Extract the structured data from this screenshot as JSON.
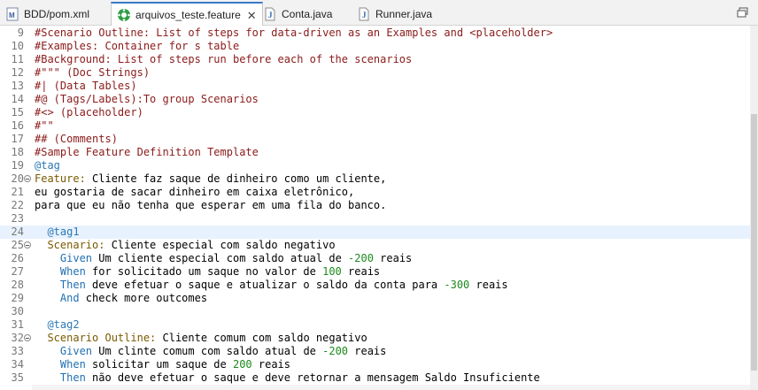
{
  "tabs": [
    {
      "label": "BDD/pom.xml",
      "icon": "maven-file-icon",
      "active": false
    },
    {
      "label": "arquivos_teste.feature",
      "icon": "cucumber-icon",
      "active": true
    },
    {
      "label": "Conta.java",
      "icon": "java-file-icon",
      "active": false
    },
    {
      "label": "Runner.java",
      "icon": "java-file-icon",
      "active": false
    }
  ],
  "colors": {
    "comment": "#8b1a1a",
    "tag": "#2d78b4",
    "keyword": "#7a5a00",
    "step": "#1f6fb2",
    "number": "#1d8a1d",
    "current_line": "#e8f2fe",
    "active_tab_accent": "#3b78c9"
  },
  "editor": {
    "current_line": 24,
    "lines": [
      {
        "n": "9",
        "segs": [
          {
            "t": "#Scenario Outline: List of steps for data-driven as an Examples and <placeholder>",
            "c": "comment"
          }
        ]
      },
      {
        "n": "10",
        "segs": [
          {
            "t": "#Examples: Container for s table",
            "c": "comment"
          }
        ]
      },
      {
        "n": "11",
        "segs": [
          {
            "t": "#Background: List of steps run before each of the scenarios",
            "c": "comment"
          }
        ]
      },
      {
        "n": "12",
        "segs": [
          {
            "t": "#\"\"\" (Doc Strings)",
            "c": "comment"
          }
        ]
      },
      {
        "n": "13",
        "segs": [
          {
            "t": "#| (Data Tables)",
            "c": "comment"
          }
        ]
      },
      {
        "n": "14",
        "segs": [
          {
            "t": "#@ (Tags/Labels):To group Scenarios",
            "c": "comment"
          }
        ]
      },
      {
        "n": "15",
        "segs": [
          {
            "t": "#<> (placeholder)",
            "c": "comment"
          }
        ]
      },
      {
        "n": "16",
        "segs": [
          {
            "t": "#\"\"",
            "c": "comment"
          }
        ]
      },
      {
        "n": "17",
        "segs": [
          {
            "t": "## (Comments)",
            "c": "comment"
          }
        ]
      },
      {
        "n": "18",
        "segs": [
          {
            "t": "#Sample Feature Definition Template",
            "c": "comment"
          }
        ]
      },
      {
        "n": "19",
        "segs": [
          {
            "t": "@tag",
            "c": "tag"
          }
        ]
      },
      {
        "n": "20",
        "fold": true,
        "segs": [
          {
            "t": "Feature:",
            "c": "kw"
          },
          {
            "t": " Cliente faz saque de dinheiro como um cliente,",
            "c": "text"
          }
        ]
      },
      {
        "n": "21",
        "segs": [
          {
            "t": "eu gostaria de sacar dinheiro em caixa eletrônico,",
            "c": "text"
          }
        ]
      },
      {
        "n": "22",
        "segs": [
          {
            "t": "para que eu não tenha que esperar em uma fila do banco.",
            "c": "text"
          }
        ]
      },
      {
        "n": "23",
        "segs": []
      },
      {
        "n": "24",
        "segs": [
          {
            "t": "  @tag1",
            "c": "tag"
          }
        ]
      },
      {
        "n": "25",
        "fold": true,
        "segs": [
          {
            "t": "  Scenario:",
            "c": "kw"
          },
          {
            "t": " Cliente especial com saldo negativo",
            "c": "text"
          }
        ]
      },
      {
        "n": "26",
        "segs": [
          {
            "t": "    Given",
            "c": "step"
          },
          {
            "t": " Um cliente especial com saldo atual de ",
            "c": "text"
          },
          {
            "t": "-200",
            "c": "num"
          },
          {
            "t": " reais",
            "c": "text"
          }
        ]
      },
      {
        "n": "27",
        "segs": [
          {
            "t": "    When",
            "c": "step"
          },
          {
            "t": " for solicitado um saque no valor de ",
            "c": "text"
          },
          {
            "t": "100",
            "c": "num"
          },
          {
            "t": " reais",
            "c": "text"
          }
        ]
      },
      {
        "n": "28",
        "segs": [
          {
            "t": "    Then",
            "c": "step"
          },
          {
            "t": " deve efetuar o saque e atualizar o saldo da conta para ",
            "c": "text"
          },
          {
            "t": "-300",
            "c": "num"
          },
          {
            "t": " reais",
            "c": "text"
          }
        ]
      },
      {
        "n": "29",
        "segs": [
          {
            "t": "    And",
            "c": "step"
          },
          {
            "t": " check more outcomes",
            "c": "text"
          }
        ]
      },
      {
        "n": "30",
        "segs": []
      },
      {
        "n": "31",
        "segs": [
          {
            "t": "  @tag2",
            "c": "tag"
          }
        ]
      },
      {
        "n": "32",
        "fold": true,
        "segs": [
          {
            "t": "  Scenario Outline:",
            "c": "kw"
          },
          {
            "t": " Cliente comum com saldo negativo",
            "c": "text"
          }
        ]
      },
      {
        "n": "33",
        "segs": [
          {
            "t": "    Given",
            "c": "step"
          },
          {
            "t": " Um clinte comum com saldo atual de ",
            "c": "text"
          },
          {
            "t": "-200",
            "c": "num"
          },
          {
            "t": " reais",
            "c": "text"
          }
        ]
      },
      {
        "n": "34",
        "segs": [
          {
            "t": "    When",
            "c": "step"
          },
          {
            "t": " solicitar um saque de ",
            "c": "text"
          },
          {
            "t": "200",
            "c": "num"
          },
          {
            "t": " reais",
            "c": "text"
          }
        ]
      },
      {
        "n": "35",
        "segs": [
          {
            "t": "    Then",
            "c": "step"
          },
          {
            "t": " não deve efetuar o saque e deve retornar a mensagem Saldo Insuficiente",
            "c": "text"
          }
        ]
      }
    ]
  }
}
